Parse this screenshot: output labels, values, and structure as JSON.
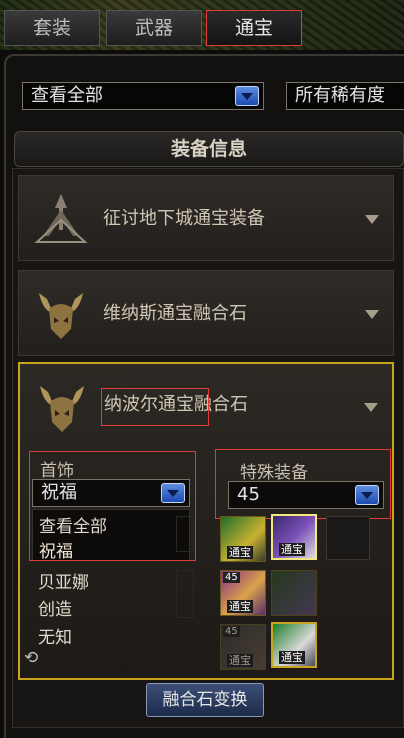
{
  "tabs": [
    {
      "label": "套装",
      "active": false
    },
    {
      "label": "武器",
      "active": false
    },
    {
      "label": "通宝",
      "active": true
    }
  ],
  "filters": {
    "view_selected": "查看全部",
    "rarity_selected": "所有稀有度"
  },
  "section_title": "装备信息",
  "categories": [
    {
      "name": "征讨地下城通宝装备",
      "expanded": false,
      "icon": "crest-icon"
    },
    {
      "name": "维纳斯通宝融合石",
      "expanded": false,
      "icon": "horned-skull-icon"
    },
    {
      "name": "纳波尔通宝融合石",
      "expanded": true,
      "icon": "horned-skull-icon"
    }
  ],
  "expanded": {
    "slot_label": "首饰",
    "slot_selected": "祝福",
    "slot_options": [
      "查看全部",
      "祝福"
    ],
    "more_items": [
      "贝亚娜",
      "创造",
      "无知"
    ],
    "special_label": "特殊装备",
    "special_selected": "45",
    "icon_tag": "通宝",
    "level_tag": "45"
  },
  "footer_button": "融合石变换",
  "colors": {
    "highlight": "#c9a41f",
    "annotation": "#e23a3a",
    "dropdown_button": "#2f64c8"
  }
}
